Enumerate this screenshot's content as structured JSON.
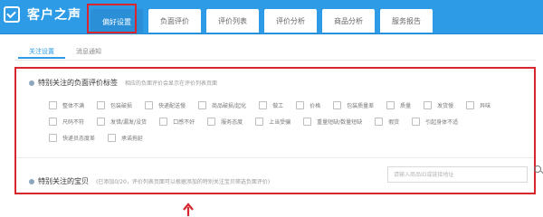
{
  "app": {
    "title": "客户之声"
  },
  "nav": {
    "tabs": [
      {
        "label": "偏好设置",
        "active": true
      },
      {
        "label": "负面评价",
        "active": false
      },
      {
        "label": "评价列表",
        "active": false
      },
      {
        "label": "评价分析",
        "active": false
      },
      {
        "label": "商品分析",
        "active": false
      },
      {
        "label": "服务报告",
        "active": false
      }
    ]
  },
  "subtabs": [
    {
      "label": "关注设置",
      "active": true
    },
    {
      "label": "消息通知",
      "active": false
    }
  ],
  "negative_tags": {
    "title": "特别关注的负面评价标签",
    "hint": "相应的负面评价会显示在评价列表页面",
    "rows": [
      [
        "整体不满",
        "包装破损",
        "快递配送慢",
        "商品破损/起化",
        "做工",
        "价格",
        "包装质量差",
        "质量",
        "发货慢",
        "异味"
      ],
      [
        "尺码不符",
        "发错/漏发/没货",
        "口感不好",
        "服务态度",
        "上当受骗",
        "重量短缺/数量短缺",
        "假货",
        "引起身体不适"
      ],
      [
        "快递员态度差",
        "承诺拖延"
      ]
    ]
  },
  "attention_items": {
    "title": "特别关注的宝贝",
    "hint": "(已添加0/20，评价列表页面可以根据添加的特别关注宝贝筛选负面评价)",
    "search_placeholder": "请输入商品ID或链接地址"
  },
  "colors": {
    "header": "#2d9be6",
    "active_tab": "#2b8fd8",
    "annotation": "#d9262e"
  }
}
